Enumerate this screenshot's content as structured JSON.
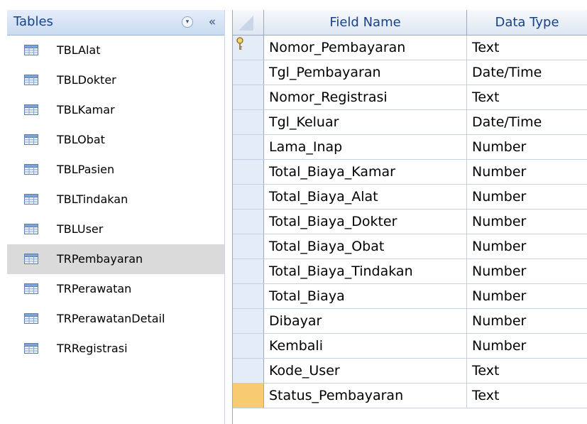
{
  "nav": {
    "title": "Tables",
    "dropdown_glyph": "▾",
    "collapse_glyph": "«",
    "selected_item": "TRPembayaran",
    "items": [
      {
        "label": "TBLAlat",
        "icon": "table-icon"
      },
      {
        "label": "TBLDokter",
        "icon": "table-icon"
      },
      {
        "label": "TBLKamar",
        "icon": "table-icon"
      },
      {
        "label": "TBLObat",
        "icon": "table-icon"
      },
      {
        "label": "TBLPasien",
        "icon": "table-icon"
      },
      {
        "label": "TBLTindakan",
        "icon": "table-icon"
      },
      {
        "label": "TBLUser",
        "icon": "table-icon"
      },
      {
        "label": "TRPembayaran",
        "icon": "table-icon"
      },
      {
        "label": "TRPerawatan",
        "icon": "table-icon"
      },
      {
        "label": "TRPerawatanDetail",
        "icon": "table-icon"
      },
      {
        "label": "TRRegistrasi",
        "icon": "table-icon"
      }
    ]
  },
  "design": {
    "columns": {
      "field_name": "Field Name",
      "data_type": "Data Type"
    },
    "primary_key_field": "Nomor_Pembayaran",
    "current_row_field": "Status_Pembayaran",
    "rows": [
      {
        "field": "Nomor_Pembayaran",
        "type": "Text"
      },
      {
        "field": "Tgl_Pembayaran",
        "type": "Date/Time"
      },
      {
        "field": "Nomor_Registrasi",
        "type": "Text"
      },
      {
        "field": "Tgl_Keluar",
        "type": "Date/Time"
      },
      {
        "field": "Lama_Inap",
        "type": "Number"
      },
      {
        "field": "Total_Biaya_Kamar",
        "type": "Number"
      },
      {
        "field": "Total_Biaya_Alat",
        "type": "Number"
      },
      {
        "field": "Total_Biaya_Dokter",
        "type": "Number"
      },
      {
        "field": "Total_Biaya_Obat",
        "type": "Number"
      },
      {
        "field": "Total_Biaya_Tindakan",
        "type": "Number"
      },
      {
        "field": "Total_Biaya",
        "type": "Number"
      },
      {
        "field": "Dibayar",
        "type": "Number"
      },
      {
        "field": "Kembali",
        "type": "Number"
      },
      {
        "field": "Kode_User",
        "type": "Text"
      },
      {
        "field": "Status_Pembayaran",
        "type": "Text"
      }
    ]
  },
  "colors": {
    "header_text": "#15428b",
    "selected_nav_bg": "#dadada",
    "current_row_selector": "#f9cb70"
  }
}
